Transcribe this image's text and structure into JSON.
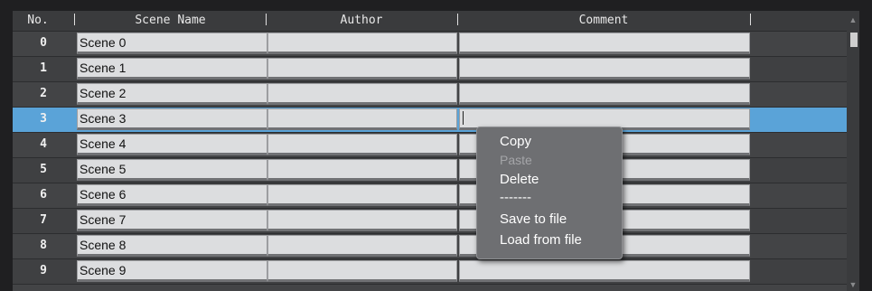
{
  "header": {
    "no": "No.",
    "scene_name": "Scene Name",
    "author": "Author",
    "comment": "Comment"
  },
  "rows": [
    {
      "no": "0",
      "name": "Scene 0"
    },
    {
      "no": "1",
      "name": "Scene 1"
    },
    {
      "no": "2",
      "name": "Scene 2"
    },
    {
      "no": "3",
      "name": "Scene 3"
    },
    {
      "no": "4",
      "name": "Scene 4"
    },
    {
      "no": "5",
      "name": "Scene 5"
    },
    {
      "no": "6",
      "name": "Scene 6"
    },
    {
      "no": "7",
      "name": "Scene 7"
    },
    {
      "no": "8",
      "name": "Scene 8"
    },
    {
      "no": "9",
      "name": "Scene 9"
    }
  ],
  "selected_row": 3,
  "context_menu": {
    "copy": "Copy",
    "paste": "Paste",
    "delete": "Delete",
    "separator": "-------",
    "save": "Save to file",
    "load": "Load from file"
  },
  "icons": {
    "scroll_up": "chevron-up-icon",
    "scroll_down": "chevron-down-icon"
  },
  "colors": {
    "selection": "#5aa3d8",
    "field": "#dcdddf",
    "menu": "#6e6f72"
  }
}
